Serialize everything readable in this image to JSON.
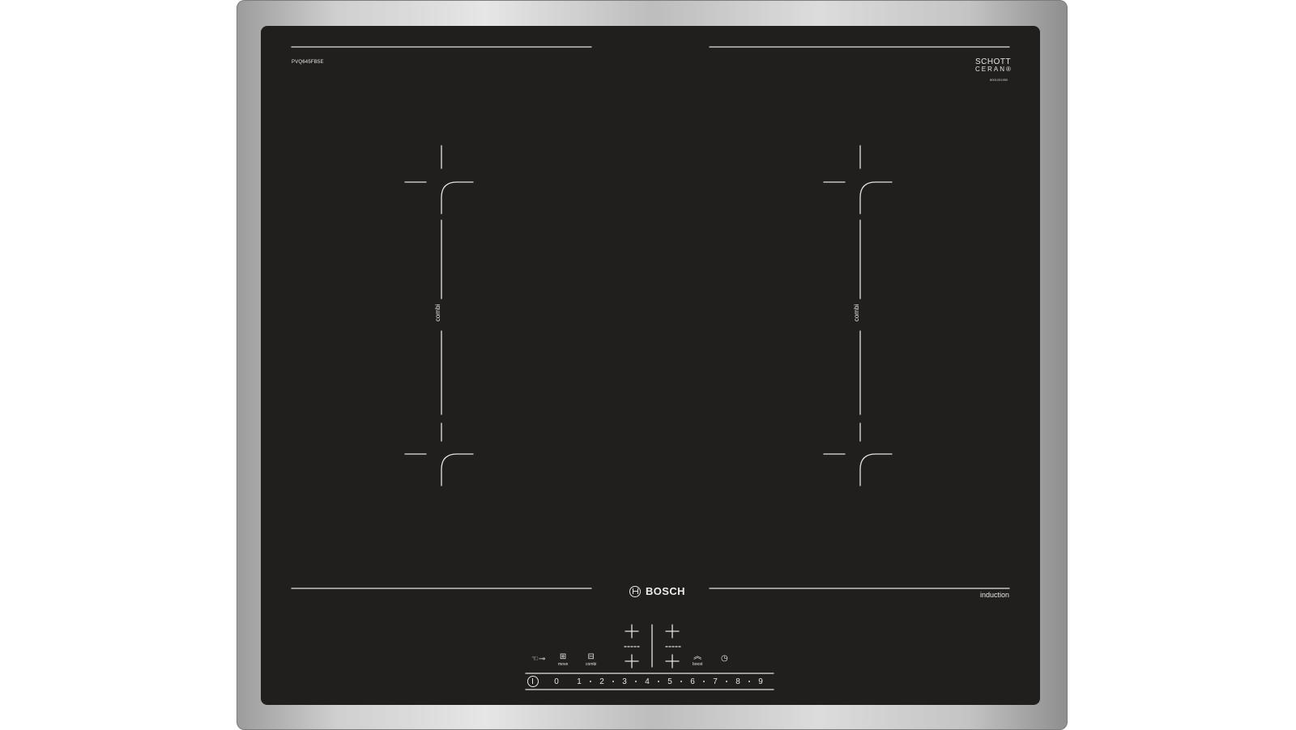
{
  "hob": {
    "model_label": "PVQ645FB5E",
    "glass_brand_top": "SCHOTT",
    "glass_brand_bottom": "CERAN®",
    "serial": "8001051950",
    "zone_labels": [
      "combi",
      "combi"
    ],
    "brand": "BOSCH",
    "type_label": "induction"
  },
  "controls": {
    "lock_icon": "hand-key-icon",
    "move": {
      "icon": "move-icon",
      "label": "move"
    },
    "combi": {
      "icon": "combi-icon",
      "label": "combi"
    },
    "boost": {
      "icon": "boost-chevron-icon",
      "label": "boost"
    },
    "timer_icon": "clock-icon",
    "power_icon": "power-icon",
    "power_levels": [
      "0",
      "1",
      "2",
      "3",
      "4",
      "5",
      "6",
      "7",
      "8",
      "9"
    ]
  },
  "colors": {
    "glass": "#201f1d",
    "print": "#e8e8e8",
    "frame": "#c8c8c8"
  }
}
